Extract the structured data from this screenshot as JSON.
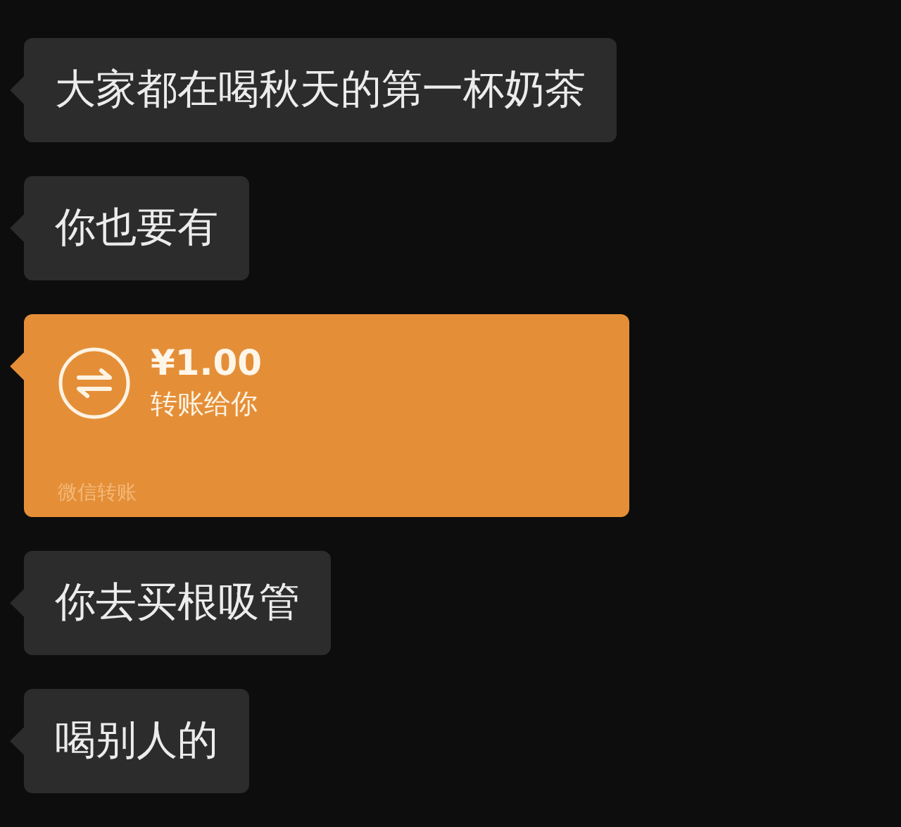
{
  "messages": [
    {
      "kind": "text",
      "text": "大家都在喝秋天的第一杯奶茶"
    },
    {
      "kind": "text",
      "text": "你也要有"
    },
    {
      "kind": "transfer",
      "amount": "¥1.00",
      "note": "转账给你",
      "footer": "微信转账"
    },
    {
      "kind": "text",
      "text": "你去买根吸管"
    },
    {
      "kind": "text",
      "text": "喝别人的"
    }
  ]
}
